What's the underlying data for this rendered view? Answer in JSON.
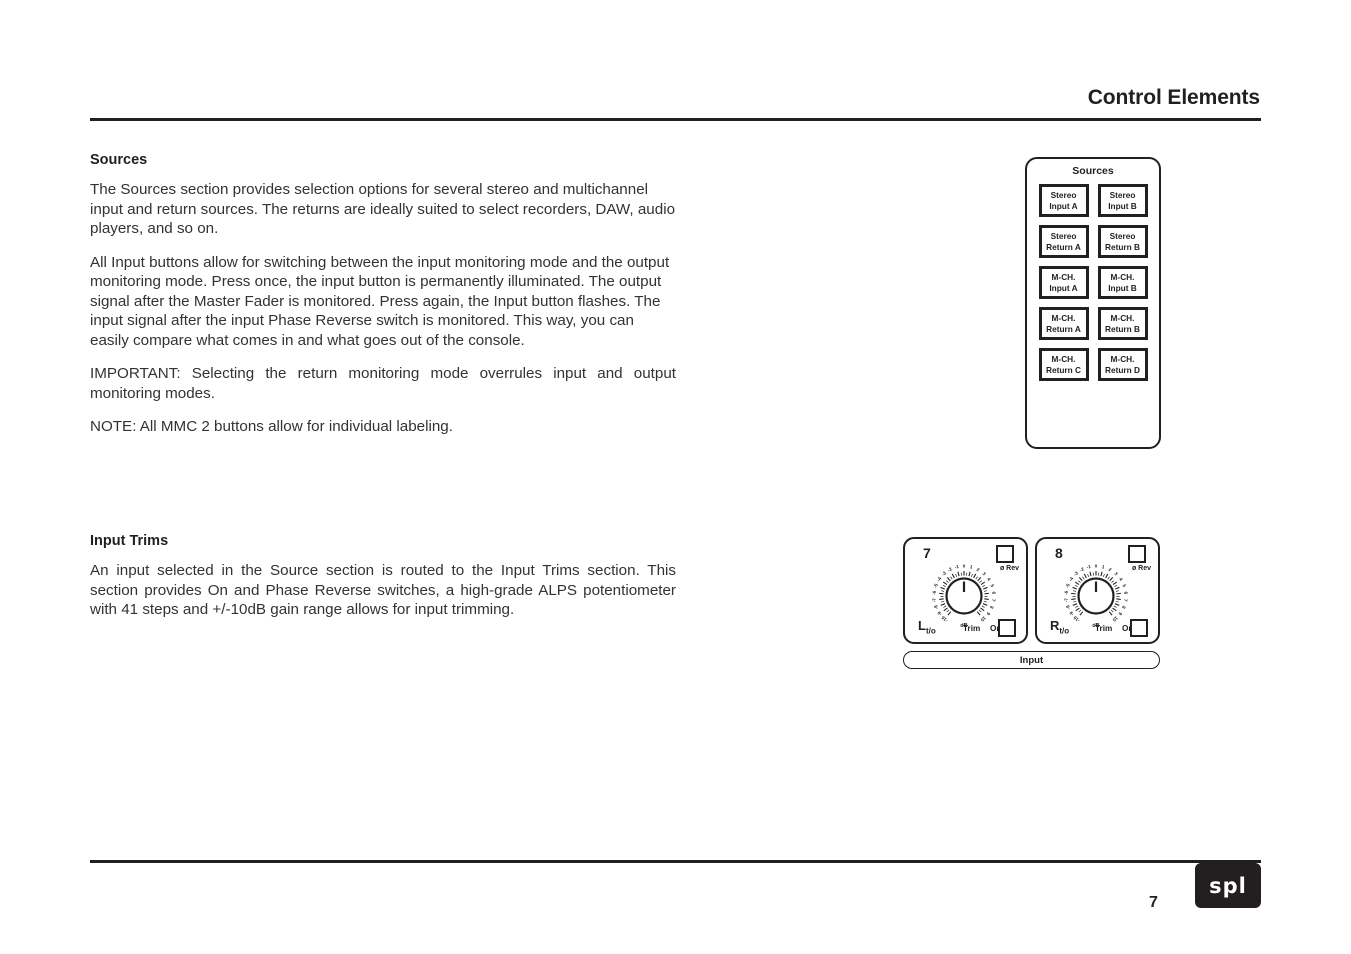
{
  "header": {
    "title": "Control Elements"
  },
  "footer": {
    "page_number": "7",
    "logo_text": "spl"
  },
  "sections": [
    {
      "heading": "Sources",
      "paragraphs": [
        "The Sources section provides selection options for several stereo and multichannel input and return sources. The returns are ideally suited to select recorders, DAW, audio players, and so on.",
        "All Input buttons allow for switching between the input monitoring mode and the output monitoring mode. Press once, the input button is permanently illuminated. The output signal after the Master Fader is monitored. Press again, the Input button flashes. The input signal after the input Phase Reverse switch is monitored. This way, you can easily compare what comes in and what goes out of the console.",
        "IMPORTANT: Selecting the return monitoring mode overrules input and output monitoring modes.",
        "NOTE: All MMC 2 buttons allow for individual labeling."
      ]
    },
    {
      "heading": "Input Trims",
      "paragraphs": [
        "An input selected in the Source section is routed to the Input Trims section. This section provides On and Phase Reverse switches, a high-grade ALPS potentiometer with 41 steps and +/-10dB gain range allows for input trimming."
      ]
    }
  ],
  "sources_panel": {
    "title": "Sources",
    "buttons": [
      {
        "line1": "Stereo",
        "line2": "Input A"
      },
      {
        "line1": "Stereo",
        "line2": "Input B"
      },
      {
        "line1": "Stereo",
        "line2": "Return A"
      },
      {
        "line1": "Stereo",
        "line2": "Return B"
      },
      {
        "line1": "M-CH.",
        "line2": "Input A"
      },
      {
        "line1": "M-CH.",
        "line2": "Input B"
      },
      {
        "line1": "M-CH.",
        "line2": "Return A"
      },
      {
        "line1": "M-CH.",
        "line2": "Return B"
      },
      {
        "line1": "M-CH.",
        "line2": "Return C"
      },
      {
        "line1": "M-CH.",
        "line2": "Return D"
      }
    ]
  },
  "input_trims_panel": {
    "bar_label": "Input",
    "channels": [
      {
        "number": "7",
        "channel_letter": "L",
        "channel_sub": "t/o",
        "rev_label": "ø Rev",
        "trim_label": "Trim",
        "on_label": "On",
        "knob": {
          "unit": "dB",
          "min": -10,
          "max": 10,
          "value": 0,
          "tick_labels": [
            "-10",
            "-9",
            "-8",
            "-7",
            "-6",
            "-5",
            "-4",
            "-3",
            "-2",
            "-1",
            "0",
            "1",
            "2",
            "3",
            "4",
            "5",
            "6",
            "7",
            "8",
            "9",
            "10"
          ]
        }
      },
      {
        "number": "8",
        "channel_letter": "R",
        "channel_sub": "t/o",
        "rev_label": "ø Rev",
        "trim_label": "Trim",
        "on_label": "On",
        "knob": {
          "unit": "dB",
          "min": -10,
          "max": 10,
          "value": 0,
          "tick_labels": [
            "-10",
            "-9",
            "-8",
            "-7",
            "-6",
            "-5",
            "-4",
            "-3",
            "-2",
            "-1",
            "0",
            "1",
            "2",
            "3",
            "4",
            "5",
            "6",
            "7",
            "8",
            "9",
            "10"
          ]
        }
      }
    ]
  },
  "colors": {
    "ink": "#231f20",
    "body_text": "#333333",
    "page": "#ffffff"
  }
}
